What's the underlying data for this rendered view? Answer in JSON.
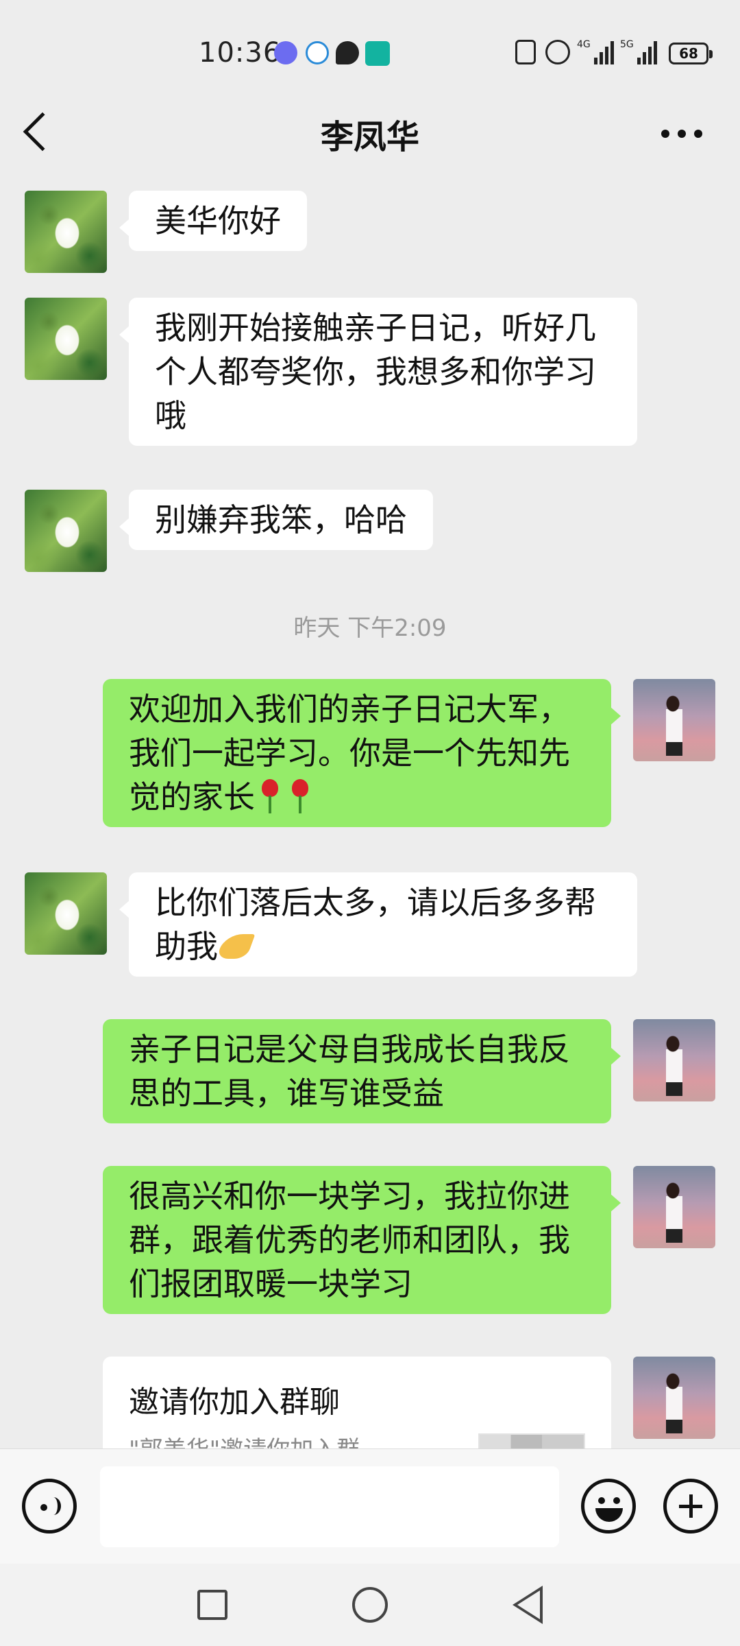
{
  "status_bar": {
    "time": "10:36",
    "battery": "68",
    "network_1": "4G",
    "network_2": "5G"
  },
  "header": {
    "title": "李凤华"
  },
  "messages": [
    {
      "side": "in",
      "text": "美华你好"
    },
    {
      "side": "in",
      "text": "我刚开始接触亲子日记，听好几个人都夸奖你，我想多和你学习哦"
    },
    {
      "side": "in",
      "text": "别嫌弃我笨，哈哈"
    },
    {
      "side": "out",
      "text": "欢迎加入我们的亲子日记大军，我们一起学习。你是一个先知先觉的家长",
      "emoji": "rose rose"
    },
    {
      "side": "in",
      "text": "比你们落后太多，请以后多多帮助我",
      "emoji": "pray"
    },
    {
      "side": "out",
      "text": "亲子日记是父母自我成长自我反思的工具，谁写谁受益"
    },
    {
      "side": "out",
      "text": "很高兴和你一块学习，我拉你进群，跟着优秀的老师和团队，我们报团取暖一块学习"
    }
  ],
  "timestamp": "昨天 下午2:09",
  "invite_card": {
    "title": "邀请你加入群聊",
    "desc": "\"郭美华\"邀请你加入群"
  },
  "input": {
    "placeholder": ""
  }
}
